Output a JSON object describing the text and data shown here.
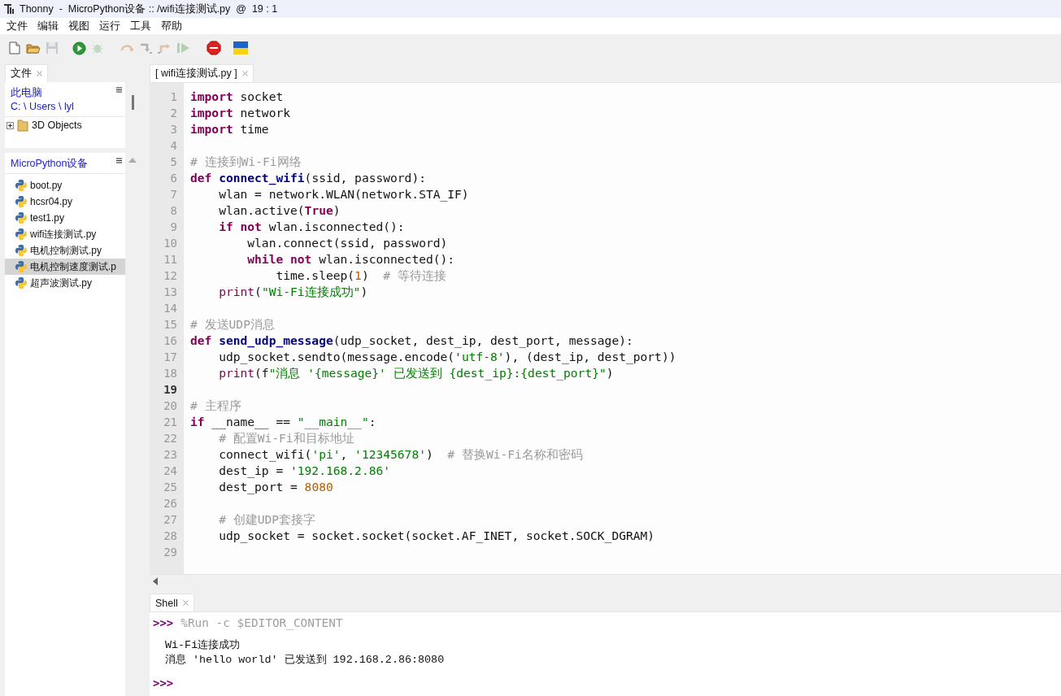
{
  "window": {
    "title": "Thonny  -  MicroPython设备 :: /wifi连接测试.py  @  19 : 1"
  },
  "menu": [
    "文件",
    "编辑",
    "视图",
    "运行",
    "工具",
    "帮助"
  ],
  "toolbar": [
    {
      "kind": "new"
    },
    {
      "kind": "open"
    },
    {
      "kind": "save",
      "disabled": true
    },
    {
      "kind": "run",
      "disabled": false
    },
    {
      "kind": "debug",
      "disabled": true
    },
    {
      "kind": "step_over",
      "disabled": true
    },
    {
      "kind": "step_into",
      "disabled": true
    },
    {
      "kind": "step_out",
      "disabled": true
    },
    {
      "kind": "resume",
      "disabled": true
    },
    {
      "kind": "stop",
      "disabled": false
    },
    {
      "kind": "flag",
      "disabled": false
    }
  ],
  "files_panel": {
    "tab": "文件",
    "computer": {
      "title": "此电脑",
      "path": "C: \\ Users \\ lyl",
      "tree": [
        {
          "label": "3D Objects",
          "expanded": false
        }
      ]
    },
    "device": {
      "title": "MicroPython设备",
      "files": [
        {
          "name": "boot.py",
          "selected": false
        },
        {
          "name": "hcsr04.py",
          "selected": false
        },
        {
          "name": "test1.py",
          "selected": false
        },
        {
          "name": "wifi连接测试.py",
          "selected": false
        },
        {
          "name": "电机控制测试.py",
          "selected": false
        },
        {
          "name": "电机控制速度测试.p",
          "selected": true
        },
        {
          "name": "超声波测试.py",
          "selected": false
        }
      ]
    }
  },
  "editor": {
    "tab": "[ wifi连接测试.py ]",
    "lines": [
      {
        "number": "1",
        "current": false,
        "tokens": [
          {
            "kind": "keyword",
            "text": "import"
          },
          {
            "kind": "plain",
            "text": " socket"
          }
        ]
      },
      {
        "number": "2",
        "current": false,
        "tokens": [
          {
            "kind": "keyword",
            "text": "import"
          },
          {
            "kind": "plain",
            "text": " network"
          }
        ]
      },
      {
        "number": "3",
        "current": false,
        "tokens": [
          {
            "kind": "keyword",
            "text": "import"
          },
          {
            "kind": "plain",
            "text": " time"
          }
        ]
      },
      {
        "number": "4",
        "current": false
      },
      {
        "number": "5",
        "current": false,
        "tokens": [
          {
            "kind": "comment",
            "text": "# 连接到Wi-Fi网络"
          }
        ]
      },
      {
        "number": "6",
        "current": false,
        "tokens": [
          {
            "kind": "keyword",
            "text": "def"
          },
          {
            "kind": "function",
            "text": " connect_wifi"
          },
          {
            "kind": "plain",
            "text": "(ssid, password):"
          }
        ]
      },
      {
        "number": "7",
        "current": false,
        "tokens": [
          {
            "kind": "plain",
            "text": "    wlan = network.WLAN(network.STA_IF)"
          }
        ]
      },
      {
        "number": "8",
        "current": false,
        "tokens": [
          {
            "kind": "plain",
            "text": "    wlan.active("
          },
          {
            "kind": "keyword",
            "text": "True"
          },
          {
            "kind": "plain",
            "text": ")"
          }
        ]
      },
      {
        "number": "9",
        "current": false,
        "tokens": [
          {
            "kind": "keyword",
            "text": "    if"
          },
          {
            "kind": "keyword",
            "text": " not"
          },
          {
            "kind": "plain",
            "text": " wlan.isconnected():"
          }
        ]
      },
      {
        "number": "10",
        "current": false,
        "tokens": [
          {
            "kind": "plain",
            "text": "        wlan.connect(ssid, password)"
          }
        ]
      },
      {
        "number": "11",
        "current": false,
        "tokens": [
          {
            "kind": "keyword",
            "text": "        while"
          },
          {
            "kind": "keyword",
            "text": " not"
          },
          {
            "kind": "plain",
            "text": " wlan.isconnected():"
          }
        ]
      },
      {
        "number": "12",
        "current": false,
        "tokens": [
          {
            "kind": "plain",
            "text": "            time.sleep("
          },
          {
            "kind": "number",
            "text": "1"
          },
          {
            "kind": "plain",
            "text": ")  "
          },
          {
            "kind": "comment",
            "text": "# 等待连接"
          }
        ]
      },
      {
        "number": "13",
        "current": false,
        "tokens": [
          {
            "kind": "builtin",
            "text": "    print"
          },
          {
            "kind": "plain",
            "text": "("
          },
          {
            "kind": "string",
            "text": "\"Wi-Fi连接成功\""
          },
          {
            "kind": "plain",
            "text": ")"
          }
        ]
      },
      {
        "number": "14",
        "current": false
      },
      {
        "number": "15",
        "current": false,
        "tokens": [
          {
            "kind": "comment",
            "text": "# 发送UDP消息"
          }
        ]
      },
      {
        "number": "16",
        "current": false,
        "tokens": [
          {
            "kind": "keyword",
            "text": "def"
          },
          {
            "kind": "function",
            "text": " send_udp_message"
          },
          {
            "kind": "plain",
            "text": "(udp_socket, dest_ip, dest_port, message):"
          }
        ]
      },
      {
        "number": "17",
        "current": false,
        "tokens": [
          {
            "kind": "plain",
            "text": "    udp_socket.sendto(message.encode("
          },
          {
            "kind": "string",
            "text": "'utf-8'"
          },
          {
            "kind": "plain",
            "text": "), (dest_ip, dest_port))"
          }
        ]
      },
      {
        "number": "18",
        "current": false,
        "tokens": [
          {
            "kind": "builtin",
            "text": "    print"
          },
          {
            "kind": "plain",
            "text": "(f"
          },
          {
            "kind": "string",
            "text": "\"消息 '{message}' 已发送到 {dest_ip}:{dest_port}\""
          },
          {
            "kind": "plain",
            "text": ")"
          }
        ]
      },
      {
        "number": "19",
        "current": true
      },
      {
        "number": "20",
        "current": false,
        "tokens": [
          {
            "kind": "comment",
            "text": "# 主程序"
          }
        ]
      },
      {
        "number": "21",
        "current": false,
        "tokens": [
          {
            "kind": "keyword",
            "text": "if"
          },
          {
            "kind": "plain",
            "text": " __name__ == "
          },
          {
            "kind": "string",
            "text": "\"__main__\""
          },
          {
            "kind": "plain",
            "text": ":"
          }
        ]
      },
      {
        "number": "22",
        "current": false,
        "tokens": [
          {
            "kind": "comment",
            "text": "    # 配置Wi-Fi和目标地址"
          }
        ]
      },
      {
        "number": "23",
        "current": false,
        "tokens": [
          {
            "kind": "plain",
            "text": "    connect_wifi("
          },
          {
            "kind": "string",
            "text": "'pi'"
          },
          {
            "kind": "plain",
            "text": ", "
          },
          {
            "kind": "string",
            "text": "'12345678'"
          },
          {
            "kind": "plain",
            "text": ")  "
          },
          {
            "kind": "comment",
            "text": "# 替换Wi-Fi名称和密码"
          }
        ]
      },
      {
        "number": "24",
        "current": false,
        "tokens": [
          {
            "kind": "plain",
            "text": "    dest_ip = "
          },
          {
            "kind": "string",
            "text": "'192.168.2.86'"
          }
        ]
      },
      {
        "number": "25",
        "current": false,
        "tokens": [
          {
            "kind": "plain",
            "text": "    dest_port = "
          },
          {
            "kind": "number",
            "text": "8080"
          }
        ]
      },
      {
        "number": "26",
        "current": false
      },
      {
        "number": "27",
        "current": false,
        "tokens": [
          {
            "kind": "comment",
            "text": "    # 创建UDP套接字"
          }
        ]
      },
      {
        "number": "28",
        "current": false,
        "tokens": [
          {
            "kind": "plain",
            "text": "    udp_socket = socket.socket(socket.AF_INET, socket.SOCK_DGRAM)"
          }
        ]
      },
      {
        "number": "29",
        "current": false
      }
    ]
  },
  "shell": {
    "tab": "Shell",
    "lines": [
      {
        "kind": "command",
        "prompt": ">>>",
        "text": "%Run -c $EDITOR_CONTENT"
      },
      {
        "kind": "blank"
      },
      {
        "kind": "output",
        "text": "Wi-Fi连接成功"
      },
      {
        "kind": "output",
        "text": "消息 'hello world' 已发送到 192.168.2.86:8080"
      },
      {
        "kind": "blank"
      },
      {
        "kind": "prompt",
        "prompt": ">>>"
      }
    ]
  }
}
